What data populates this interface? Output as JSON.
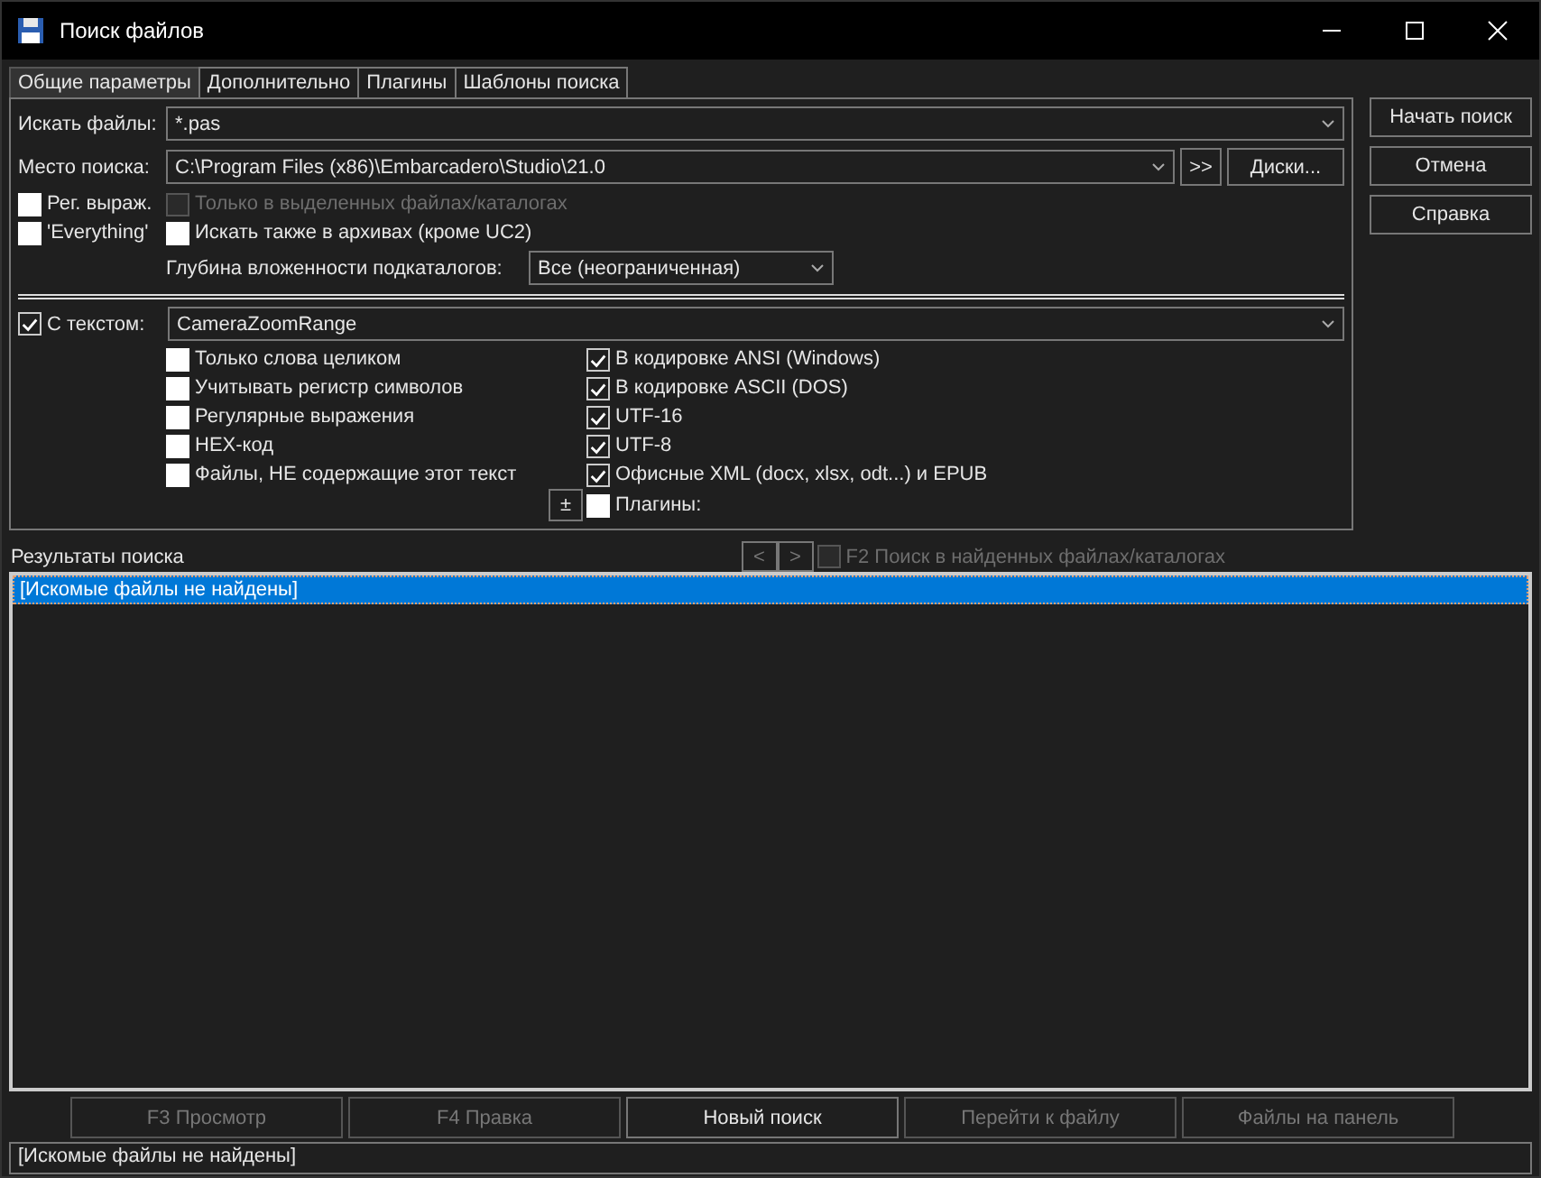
{
  "window": {
    "title": "Поиск файлов"
  },
  "tabs": [
    {
      "label": "Общие параметры",
      "selected": true
    },
    {
      "label": "Дополнительно",
      "selected": false
    },
    {
      "label": "Плагины",
      "selected": false
    },
    {
      "label": "Шаблоны поиска",
      "selected": false
    }
  ],
  "search_files": {
    "label": "Искать файлы:",
    "value": "*.pas"
  },
  "search_location": {
    "label": "Место поиска:",
    "value": "C:\\Program Files (x86)\\Embarcadero\\Studio\\21.0",
    "buttons": [
      ">>",
      "Диски..."
    ]
  },
  "options": [
    {
      "label": "Рег. выраж.",
      "checked": false,
      "disabled": false
    },
    {
      "label": "Только в выделенных файлах/каталогах",
      "checked": false,
      "disabled": true
    },
    {
      "label": "'Everything'",
      "checked": false,
      "disabled": false
    },
    {
      "label": "Искать также в архивах (кроме UC2)",
      "checked": false,
      "disabled": false
    }
  ],
  "depth": {
    "label": "Глубина вложенности подкаталогов:",
    "value": "Все (неограниченная)"
  },
  "text_search": {
    "label": "С текстом:",
    "checked": true,
    "value": "CameraZoomRange"
  },
  "text_options_left": [
    {
      "label": "Только слова целиком",
      "checked": false
    },
    {
      "label": "Учитывать регистр символов",
      "checked": false
    },
    {
      "label": "Регулярные выражения",
      "checked": false
    },
    {
      "label": "HEX-код",
      "checked": false
    },
    {
      "label": "Файлы, НЕ содержащие этот текст",
      "checked": false
    }
  ],
  "text_options_right": [
    {
      "label": "В кодировке ANSI (Windows)",
      "checked": true
    },
    {
      "label": "В кодировке ASCII (DOS)",
      "checked": true
    },
    {
      "label": "UTF-16",
      "checked": true
    },
    {
      "label": "UTF-8",
      "checked": true
    },
    {
      "label": "Офисные XML (docx, xlsx, odt...) и EPUB",
      "checked": true
    }
  ],
  "plus_button": "±",
  "plugins": {
    "label": "Плагины:",
    "checked": false
  },
  "side_buttons": [
    "Начать поиск",
    "Отмена",
    "Справка"
  ],
  "results": {
    "title": "Результаты поиска",
    "nav_buttons": [
      "<",
      ">"
    ],
    "filter": {
      "label": "F2 Поиск в найденных файлах/каталогах",
      "checked": false,
      "disabled": true
    },
    "rows": [
      {
        "text": "[Искомые файлы не найдены]",
        "selected": true
      }
    ]
  },
  "bottom_buttons": [
    {
      "label": "F3 Просмотр",
      "disabled": true
    },
    {
      "label": "F4 Правка",
      "disabled": true
    },
    {
      "label": "Новый поиск",
      "disabled": false
    },
    {
      "label": "Перейти к файлу",
      "disabled": true
    },
    {
      "label": "Файлы на панель",
      "disabled": true
    }
  ],
  "status_bar": "[Искомые файлы не найдены]"
}
